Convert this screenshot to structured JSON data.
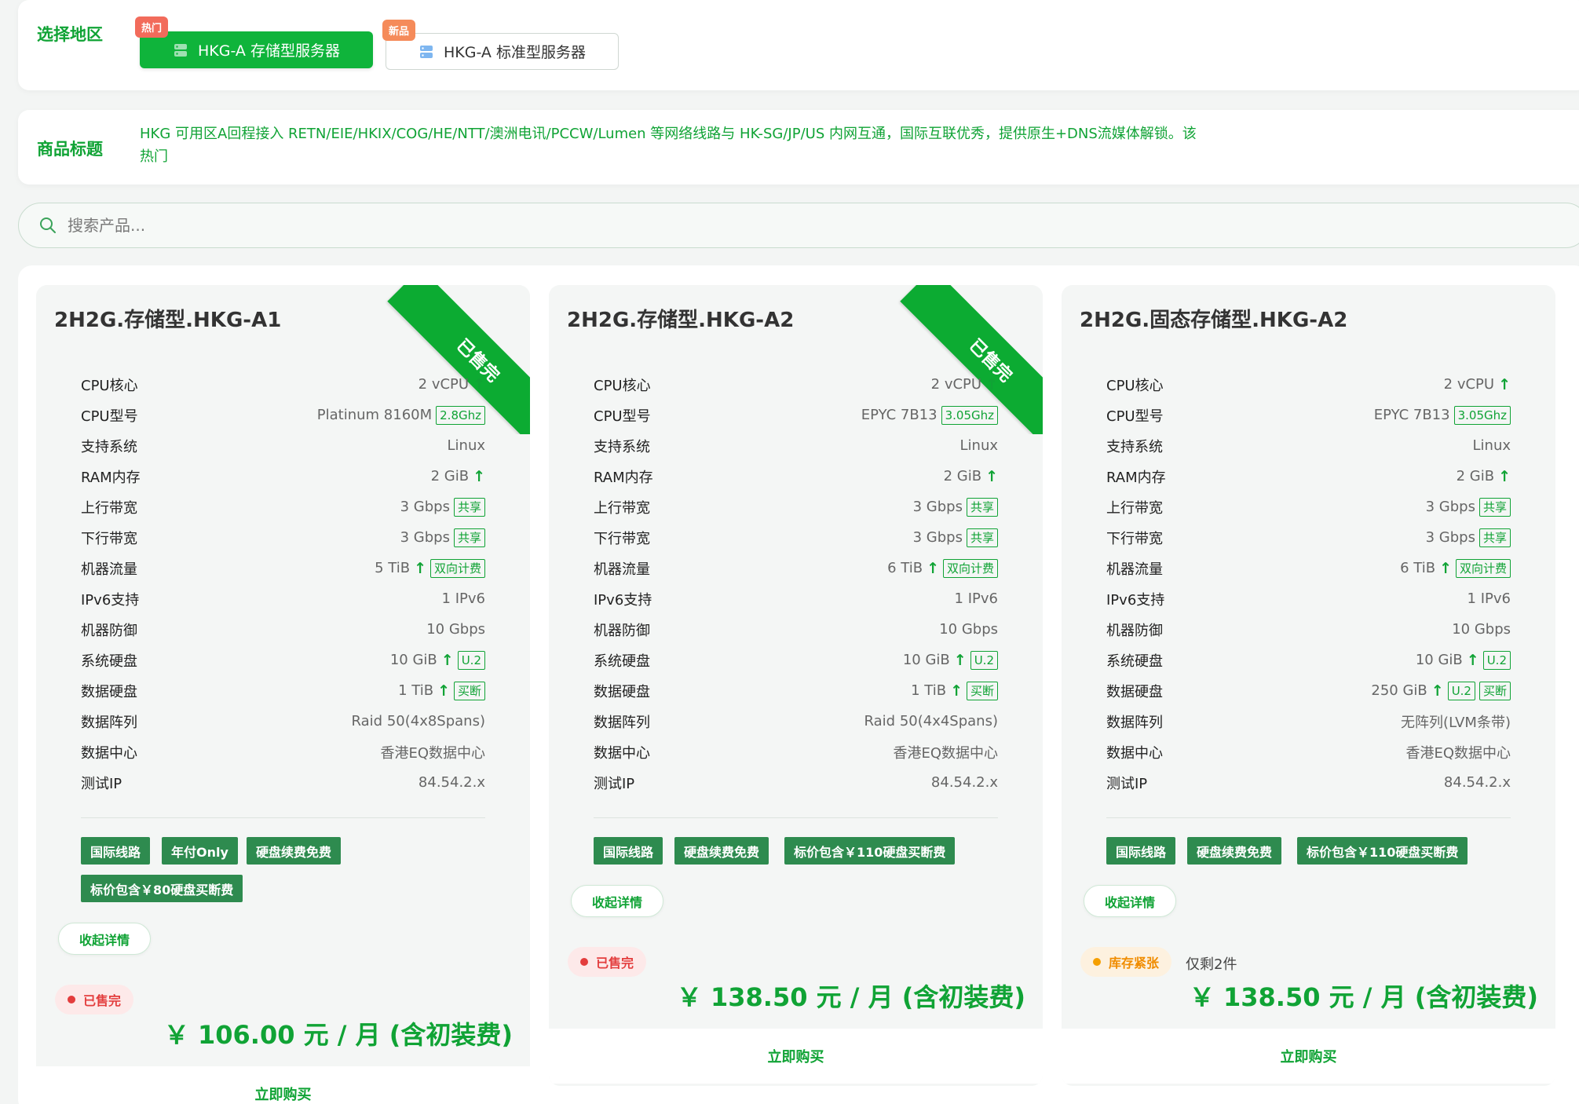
{
  "region": {
    "label": "选择地区",
    "options": [
      {
        "name": "HKG-A 存储型服务器",
        "badge": "热门",
        "badge_color": "#f26b5b",
        "active": true
      },
      {
        "name": "HKG-A 标准型服务器",
        "badge": "新品",
        "badge_color": "#f58b5a",
        "active": false
      }
    ]
  },
  "product_title": {
    "label": "商品标题",
    "text_line1": "HKG 可用区A回程接入 RETN/EIE/HKIX/COG/HE/NTT/澳洲电讯/PCCW/Lumen 等网络线路与 HK-SG/JP/US 内网互通，国际互联优秀，提供原生+DNS流媒体解锁。该",
    "text_line2": "热门"
  },
  "search": {
    "placeholder": "搜索产品..."
  },
  "colors": {
    "accent": "#10a335",
    "sold": "#e33d3d",
    "low_stock": "#f08c00"
  },
  "products": [
    {
      "name": "2H2G.存储型.HKG-A1",
      "ribbon": "已售完",
      "specs": [
        {
          "k": "CPU核心",
          "v": "2 vCPU"
        },
        {
          "k": "CPU型号",
          "v": "Platinum 8160M",
          "t1": "2.8Ghz"
        },
        {
          "k": "支持系统",
          "v": "Linux"
        },
        {
          "k": "RAM内存",
          "v": "2 GiB"
        },
        {
          "k": "上行带宽",
          "v": "3 Gbps",
          "t1": "共享"
        },
        {
          "k": "下行带宽",
          "v": "3 Gbps",
          "t1": "共享"
        },
        {
          "k": "机器流量",
          "v": "5 TiB",
          "t1": "双向计费"
        },
        {
          "k": "IPv6支持",
          "v": "1 IPv6"
        },
        {
          "k": "机器防御",
          "v": "10 Gbps"
        },
        {
          "k": "系统硬盘",
          "v": "10 GiB",
          "t1": "U.2"
        },
        {
          "k": "数据硬盘",
          "v": "1 TiB",
          "t1": "买断"
        },
        {
          "k": "数据阵列",
          "v": "Raid 50(4x8Spans)"
        },
        {
          "k": "数据中心",
          "v": "香港EQ数据中心"
        },
        {
          "k": "测试IP",
          "v": "84.54.2.x"
        }
      ],
      "tags": [
        "国际线路",
        "年付Only",
        "硬盘续费免费",
        "标价包含￥80硬盘买断费"
      ],
      "collapse": "收起详情",
      "status": "已售完",
      "price": "￥ 106.00 元 / 月 (含初装费)",
      "buy": "立即购买"
    },
    {
      "name": "2H2G.存储型.HKG-A2",
      "ribbon": "已售完",
      "specs": [
        {
          "k": "CPU核心",
          "v": "2 vCPU"
        },
        {
          "k": "CPU型号",
          "v": "EPYC 7B13",
          "t1": "3.05Ghz"
        },
        {
          "k": "支持系统",
          "v": "Linux"
        },
        {
          "k": "RAM内存",
          "v": "2 GiB"
        },
        {
          "k": "上行带宽",
          "v": "3 Gbps",
          "t1": "共享"
        },
        {
          "k": "下行带宽",
          "v": "3 Gbps",
          "t1": "共享"
        },
        {
          "k": "机器流量",
          "v": "6 TiB",
          "t1": "双向计费"
        },
        {
          "k": "IPv6支持",
          "v": "1 IPv6"
        },
        {
          "k": "机器防御",
          "v": "10 Gbps"
        },
        {
          "k": "系统硬盘",
          "v": "10 GiB",
          "t1": "U.2"
        },
        {
          "k": "数据硬盘",
          "v": "1 TiB",
          "t1": "买断"
        },
        {
          "k": "数据阵列",
          "v": "Raid 50(4x4Spans)"
        },
        {
          "k": "数据中心",
          "v": "香港EQ数据中心"
        },
        {
          "k": "测试IP",
          "v": "84.54.2.x"
        }
      ],
      "tags": [
        "国际线路",
        "硬盘续费免费",
        "标价包含￥110硬盘买断费"
      ],
      "collapse": "收起详情",
      "status": "已售完",
      "price": "￥ 138.50 元 / 月 (含初装费)",
      "buy": "立即购买"
    },
    {
      "name": "2H2G.固态存储型.HKG-A2",
      "specs": [
        {
          "k": "CPU核心",
          "v": "2 vCPU"
        },
        {
          "k": "CPU型号",
          "v": "EPYC 7B13",
          "t1": "3.05Ghz"
        },
        {
          "k": "支持系统",
          "v": "Linux"
        },
        {
          "k": "RAM内存",
          "v": "2 GiB"
        },
        {
          "k": "上行带宽",
          "v": "3 Gbps",
          "t1": "共享"
        },
        {
          "k": "下行带宽",
          "v": "3 Gbps",
          "t1": "共享"
        },
        {
          "k": "机器流量",
          "v": "6 TiB",
          "t1": "双向计费"
        },
        {
          "k": "IPv6支持",
          "v": "1 IPv6"
        },
        {
          "k": "机器防御",
          "v": "10 Gbps"
        },
        {
          "k": "系统硬盘",
          "v": "10 GiB",
          "t1": "U.2"
        },
        {
          "k": "数据硬盘",
          "v": "250 GiB",
          "t1": "U.2",
          "t2": "买断"
        },
        {
          "k": "数据阵列",
          "v": "无阵列(LVM条带)"
        },
        {
          "k": "数据中心",
          "v": "香港EQ数据中心"
        },
        {
          "k": "测试IP",
          "v": "84.54.2.x"
        }
      ],
      "tags": [
        "国际线路",
        "硬盘续费免费",
        "标价包含￥110硬盘买断费"
      ],
      "collapse": "收起详情",
      "status": "库存紧张",
      "stock_note": "仅剩2件",
      "price": "￥ 138.50 元 / 月 (含初装费)",
      "buy": "立即购买"
    }
  ]
}
